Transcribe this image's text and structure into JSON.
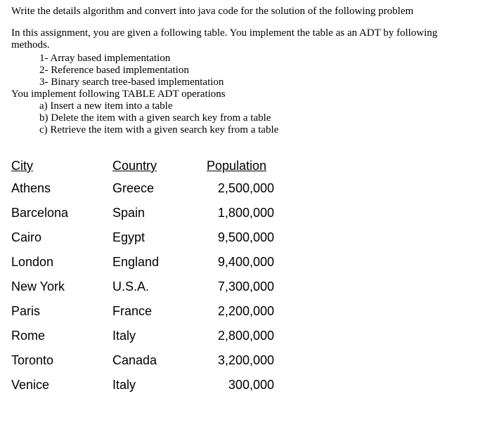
{
  "intro": "Write the details algorithm and convert into java code for the solution of the following problem",
  "assignment_lead": "In this assignment, you are given a following table. You implement the table as an ADT by following methods.",
  "impl_methods": [
    "1-  Array based implementation",
    "2-  Reference based implementation",
    "3-  Binary search tree-based implementation"
  ],
  "operations_lead": "You implement following TABLE ADT operations",
  "operations": [
    "a)  Insert a new item into a table",
    "b)  Delete the item with a given search key from a table",
    "c)  Retrieve the item with a given search key from a table"
  ],
  "table": {
    "headers": {
      "city": "City",
      "country": "Country",
      "population": "Population"
    },
    "rows": [
      {
        "city": "Athens",
        "country": "Greece",
        "population": "2,500,000"
      },
      {
        "city": "Barcelona",
        "country": "Spain",
        "population": "1,800,000"
      },
      {
        "city": "Cairo",
        "country": "Egypt",
        "population": "9,500,000"
      },
      {
        "city": "London",
        "country": "England",
        "population": "9,400,000"
      },
      {
        "city": "New York",
        "country": "U.S.A.",
        "population": "7,300,000"
      },
      {
        "city": "Paris",
        "country": "France",
        "population": "2,200,000"
      },
      {
        "city": "Rome",
        "country": "Italy",
        "population": "2,800,000"
      },
      {
        "city": "Toronto",
        "country": "Canada",
        "population": "3,200,000"
      },
      {
        "city": "Venice",
        "country": "Italy",
        "population": "300,000"
      }
    ]
  }
}
